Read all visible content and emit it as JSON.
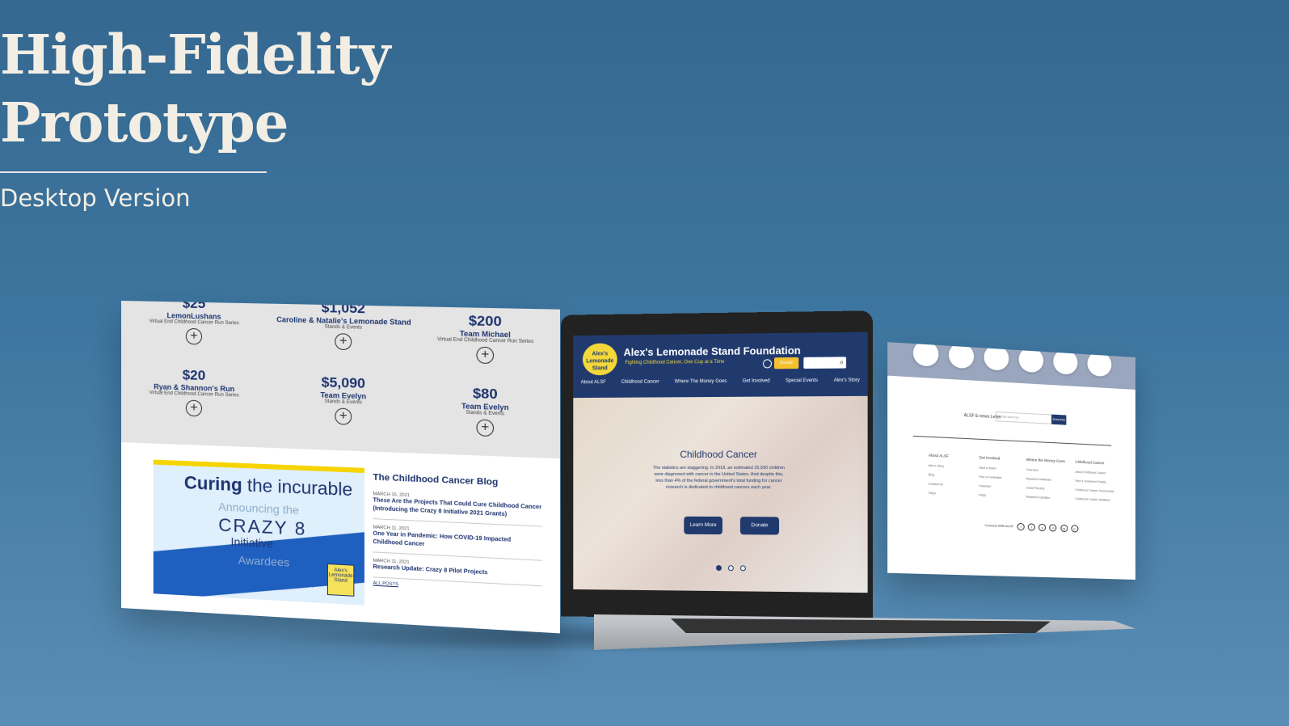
{
  "hero": {
    "title_line1": "High-Fidelity",
    "title_line2": "Prototype",
    "subtitle": "Desktop Version"
  },
  "left_panel": {
    "donors": [
      {
        "amount": "$25",
        "name": "LemonLushans",
        "event": "Virtual End Childhood Cancer Run Series"
      },
      {
        "amount": "$1,052",
        "name": "Caroline & Natalie's Lemonade Stand",
        "event": "Stands & Events"
      },
      {
        "amount": "$200",
        "name": "Team Michael",
        "event": "Virtual End Childhood Cancer Run Series"
      },
      {
        "amount": "$20",
        "name": "Ryan & Shannon's Run",
        "event": "Virtual End Childhood Cancer Run Series"
      },
      {
        "amount": "$5,090",
        "name": "Team Evelyn",
        "event": "Stands & Events"
      },
      {
        "amount": "$80",
        "name": "Team Evelyn",
        "event": "Stands & Events"
      }
    ],
    "promo": {
      "curing": "Curing",
      "the_incurable": "the incurable",
      "announcing": "Announcing the",
      "crazy": "CRAZY 8",
      "initiative": "Initiative",
      "awardees": "Awardees",
      "logo_text": "Alex's Lemonade Stand"
    },
    "blog": {
      "title": "The Childhood Cancer Blog",
      "posts": [
        {
          "date": "MARCH 16, 2021",
          "title": "These Are the Projects That Could Cure Childhood Cancer (Introducing the Crazy 8 Initiative 2021 Grants)"
        },
        {
          "date": "MARCH 11, 2021",
          "title": "One Year in Pandemic: How COVID-19 Impacted Childhood Cancer"
        },
        {
          "date": "MARCH 11, 2021",
          "title": "Research Update: Crazy 8 Pilot Projects"
        }
      ],
      "all_posts": "ALL POSTS"
    }
  },
  "laptop_site": {
    "logo_text": "Alex's Lemonade Stand",
    "site_name": "Alex's Lemonade Stand Foundation",
    "tagline": "Fighting Childhood Cancer, One Cup at a Time",
    "donate_label": "Donate",
    "nav": [
      "About ALSF",
      "Childhood Cancer",
      "Where The Money Goes",
      "Get Involved",
      "Special Events",
      "Alex's Story"
    ],
    "slide": {
      "title": "Childhood Cancer",
      "text": "The statistics are staggering. In 2018, an estimated 15,590 children were diagnosed with cancer in the United States. And despite this, less than 4% of the federal government's total funding for cancer research is dedicated to childhood cancers each year.",
      "learn_more": "Learn More",
      "donate": "Donate"
    }
  },
  "right_panel": {
    "news_label": "ALSF E-news Letter",
    "email_placeholder": "Email address",
    "subscribe": "Subscribe",
    "columns": [
      {
        "title": "About ALSF",
        "items": [
          "Alex's Story",
          "Blog",
          "Contact Us",
          "FAQs"
        ]
      },
      {
        "title": "Get Involved",
        "items": [
          "Start a Stand",
          "Find a Fundraiser",
          "Volunteer",
          "FAQs"
        ]
      },
      {
        "title": "Where the Money Goes",
        "items": [
          "Overview",
          "Research Initiatives",
          "Grant Process",
          "Research Updates"
        ]
      },
      {
        "title": "Childhood Cancer",
        "items": [
          "About Childhood Cancer",
          "Find a Treatment Facility",
          "Childhood Cancer Survivorship",
          "Childhood Cancer Statistics"
        ]
      }
    ],
    "connect": "Connect With ALSF",
    "social": [
      "f",
      "t",
      "y",
      "in",
      "ig",
      "p"
    ]
  },
  "colors": {
    "navy": "#213a6e",
    "lemon": "#f4d83a",
    "background": "#3d76a0"
  }
}
